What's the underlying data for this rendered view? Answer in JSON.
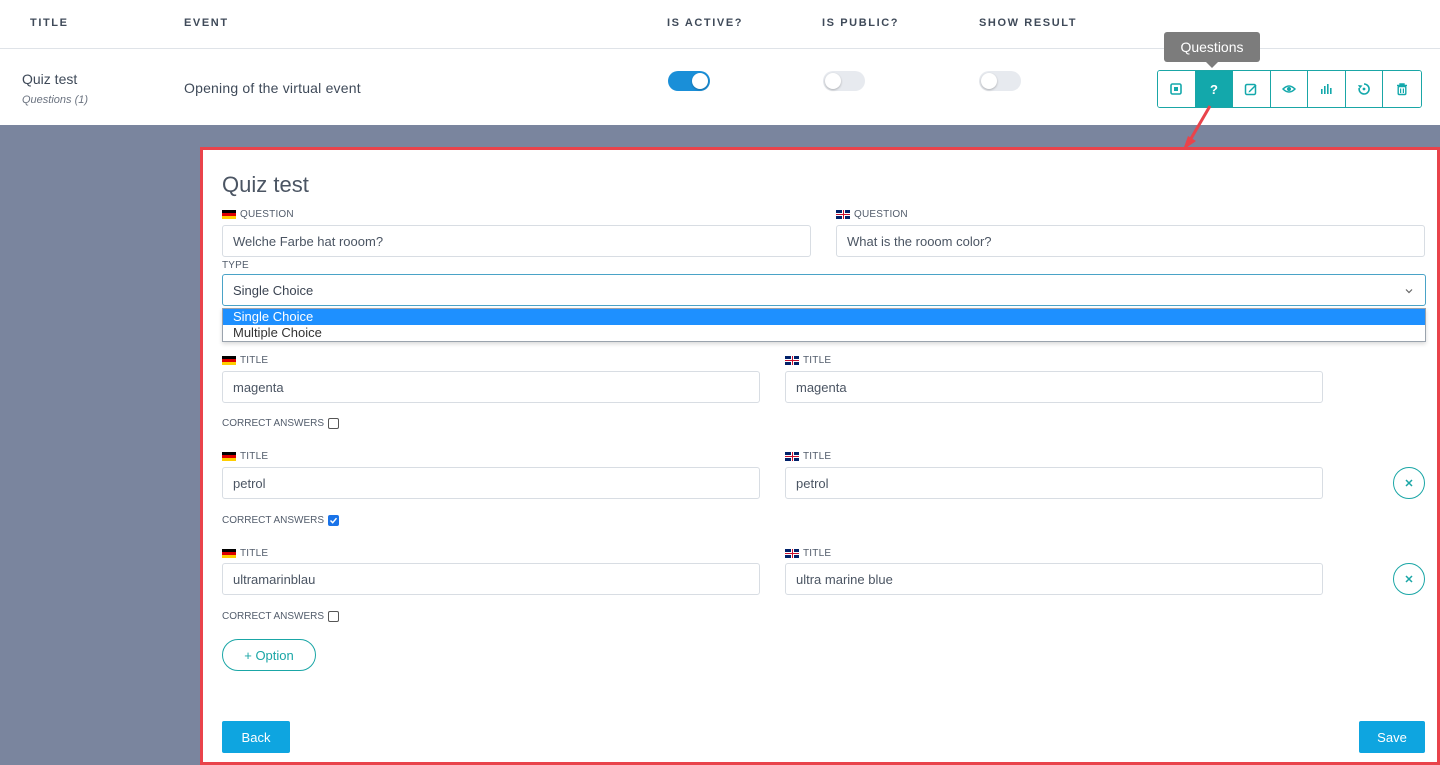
{
  "table": {
    "headers": [
      "TITLE",
      "EVENT",
      "IS ACTIVE?",
      "IS PUBLIC?",
      "SHOW RESULT"
    ],
    "row": {
      "title": "Quiz test",
      "subtitle": "Questions (1)",
      "event": "Opening of the virtual event",
      "is_active": true,
      "is_public": false,
      "show_result": false
    },
    "actions": [
      {
        "icon": "stop-icon"
      },
      {
        "icon": "question-icon",
        "active": true
      },
      {
        "icon": "edit-icon"
      },
      {
        "icon": "eye-icon"
      },
      {
        "icon": "bar-chart-icon"
      },
      {
        "icon": "reset-icon"
      },
      {
        "icon": "trash-icon"
      }
    ],
    "tooltip": "Questions"
  },
  "panel": {
    "title": "Quiz test",
    "question_label": "QUESTION",
    "question_de": "Welche Farbe hat rooom?",
    "question_en": "What is the rooom color?",
    "type_label": "TYPE",
    "type_value": "Single Choice",
    "type_options": [
      "Single Choice",
      "Multiple Choice"
    ],
    "title_label": "TITLE",
    "correct_label": "CORRECT ANSWERS",
    "options": [
      {
        "de": "magenta",
        "en": "magenta",
        "correct": false
      },
      {
        "de": "petrol",
        "en": "petrol",
        "correct": true
      },
      {
        "de": "ultramarinblau",
        "en": "ultra marine blue",
        "correct": false
      }
    ],
    "add_option": "+ Option",
    "back": "Back",
    "save": "Save"
  },
  "colors": {
    "accent_teal": "#13a8ab",
    "primary_blue": "#0ea5e0",
    "highlight_red": "#e9434b",
    "backdrop": "#7a859e"
  }
}
